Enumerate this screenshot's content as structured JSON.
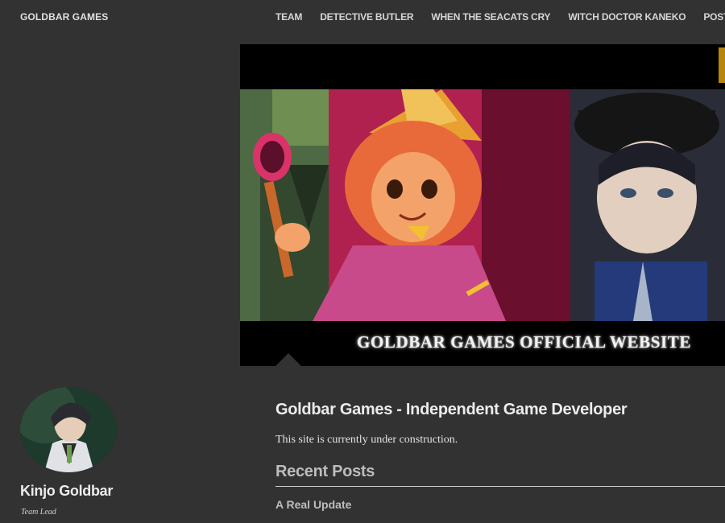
{
  "header": {
    "site_title": "GOLDBAR GAMES",
    "nav": [
      {
        "label": "TEAM"
      },
      {
        "label": "DETECTIVE BUTLER"
      },
      {
        "label": "WHEN THE SEACATS CRY"
      },
      {
        "label": "WITCH DOCTOR KANEKO"
      },
      {
        "label": "POSTS"
      }
    ]
  },
  "banner": {
    "caption": "GOLDBAR GAMES OFFICIAL WEBSITE"
  },
  "author": {
    "name": "Kinjo Goldbar",
    "role": "Team Lead"
  },
  "main": {
    "title": "Goldbar Games - Independent Game Developer",
    "body": "This site is currently under construction.",
    "recent_heading": "Recent Posts",
    "recent_posts": [
      {
        "title": "A Real Update"
      }
    ]
  },
  "colors": {
    "background": "#323232",
    "text": "#e6e6e6",
    "muted_heading": "#bdbdbd"
  }
}
